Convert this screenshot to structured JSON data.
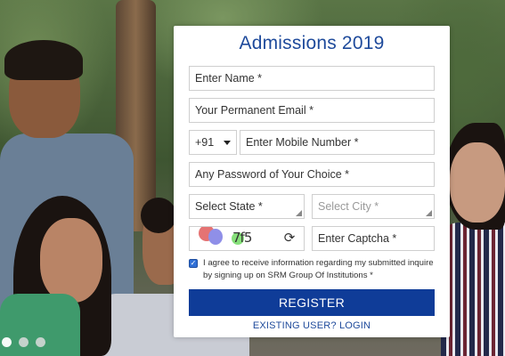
{
  "form": {
    "title": "Admissions 2019",
    "name_placeholder": "Enter Name *",
    "email_placeholder": "Your Permanent Email *",
    "phone_code": "+91",
    "mobile_placeholder": "Enter Mobile Number *",
    "password_placeholder": "Any Password of Your Choice *",
    "state_label": "Select State *",
    "city_label": "Select City *",
    "captcha_text": "7f5",
    "captcha_placeholder": "Enter Captcha *",
    "consent_text": "I agree to receive information regarding my submitted inquire by signing up on SRM Group Of Institutions *",
    "consent_checked": true,
    "register_label": "REGISTER",
    "login_label": "EXISTING USER? LOGIN"
  },
  "colors": {
    "accent": "#1e4a9b",
    "button": "#0f3c98",
    "checkbox": "#2f6fd6"
  },
  "carousel": {
    "dots": 3,
    "active_index": 0
  }
}
